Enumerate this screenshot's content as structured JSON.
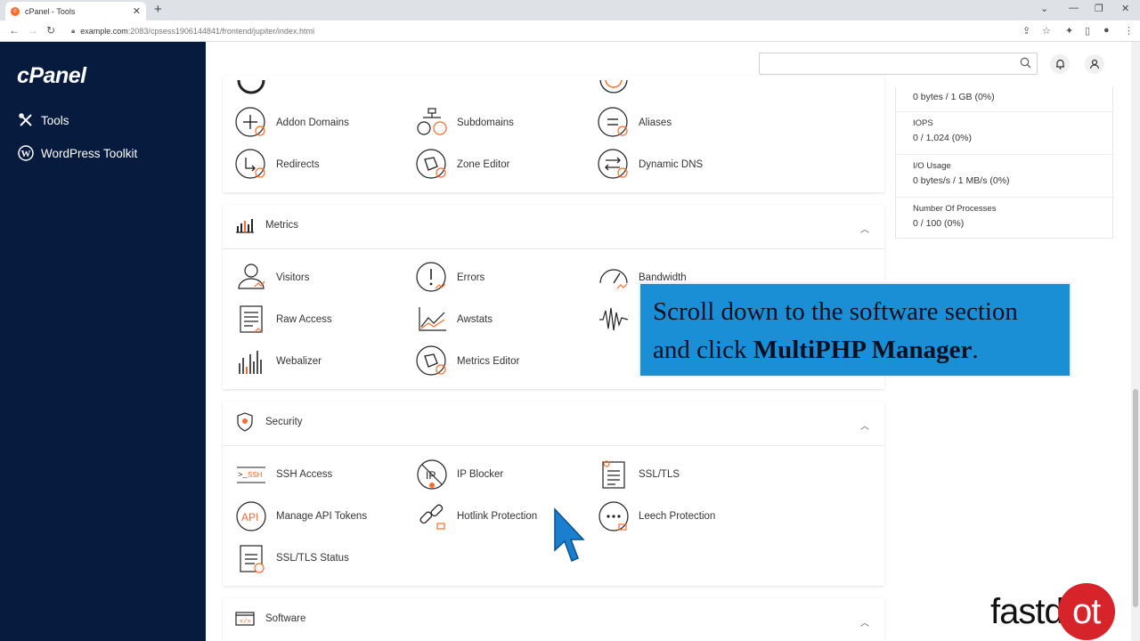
{
  "browser": {
    "tab_title": "cPanel - Tools",
    "tab_close": "✕",
    "new_tab": "+",
    "url_host": "example.com",
    "url_path": ":2083/cpsess1906144841/frontend/jupiter/index.html"
  },
  "sidebar": {
    "logo": "cPanel",
    "items": [
      {
        "label": "Tools",
        "icon": "tools-icon"
      },
      {
        "label": "WordPress Toolkit",
        "icon": "wordpress-icon"
      }
    ]
  },
  "search": {
    "placeholder": ""
  },
  "domains_rows": [
    [
      "Addon Domains",
      "Subdomains",
      "Aliases"
    ],
    [
      "Redirects",
      "Zone Editor",
      "Dynamic DNS"
    ]
  ],
  "metrics": {
    "title": "Metrics",
    "items": [
      "Visitors",
      "Errors",
      "Bandwidth",
      "Raw Access",
      "Awstats",
      "Webalizer",
      "Metrics Editor"
    ]
  },
  "security": {
    "title": "Security",
    "items": [
      "SSH Access",
      "IP Blocker",
      "SSL/TLS",
      "Manage API Tokens",
      "Hotlink Protection",
      "Leech Protection",
      "SSL/TLS Status"
    ]
  },
  "software": {
    "title": "Software"
  },
  "stats": {
    "first_value": "0 bytes / 1 GB   (0%)",
    "iops_label": "IOPS",
    "iops_value": "0 / 1,024   (0%)",
    "io_label": "I/O Usage",
    "io_value": "0 bytes/s / 1 MB/s   (0%)",
    "proc_label": "Number Of Processes",
    "proc_value": "0 / 100   (0%)"
  },
  "caption": {
    "line1": "Scroll down to the software section",
    "line2_prefix": "and click ",
    "line2_bold": "MultiPHP Manager",
    "line2_suffix": "."
  },
  "brand": {
    "text": "fastd",
    "dot_text": "ot"
  },
  "colors": {
    "sidebar": "#061b3e",
    "accent": "#ff6c2c",
    "caption_bg": "#1b8fd6",
    "brand_red": "#d7232a"
  }
}
